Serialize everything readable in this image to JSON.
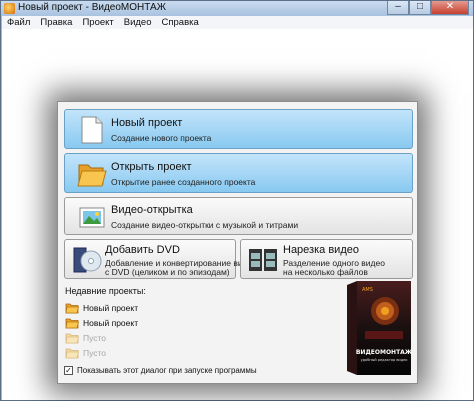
{
  "window": {
    "title": "Новый проект - ВидеоМОНТАЖ",
    "minimize": "–",
    "maximize": "□",
    "close": "✕"
  },
  "menu": [
    "Файл",
    "Правка",
    "Проект",
    "Видео",
    "Справка"
  ],
  "dialog": {
    "new_project": {
      "title": "Новый проект",
      "desc": "Создание нового проекта",
      "icon": "document-icon"
    },
    "open_project": {
      "title": "Открыть проект",
      "desc": "Открытие ранее созданного проекта",
      "icon": "folder-icon"
    },
    "video_card": {
      "title": "Видео-открытка",
      "desc": "Создание видео-открытки с музыкой и титрами",
      "icon": "postcard-icon"
    },
    "add_dvd": {
      "title": "Добавить DVD",
      "desc_line1": "Добавление и конвертирование видео",
      "desc_line2": "с DVD (целиком и по эпизодам)",
      "icon": "dvd-icon"
    },
    "cut_video": {
      "title": "Нарезка видео",
      "desc_line1": "Разделение одного видео",
      "desc_line2": "на несколько файлов",
      "icon": "film-icon"
    },
    "recent_label": "Недавние проекты:",
    "recent": [
      {
        "label": "Новый проект",
        "empty": false
      },
      {
        "label": "Новый проект",
        "empty": false
      },
      {
        "label": "Пусто",
        "empty": true
      },
      {
        "label": "Пусто",
        "empty": true
      }
    ],
    "show_on_start": {
      "label": "Показывать этот диалог при запуске программы",
      "checked": true
    },
    "product": {
      "brand": "AMS",
      "name": "ВИДЕОМОНТАЖ",
      "tagline": "удобный редактор видео"
    }
  },
  "colors": {
    "active_card": "#88c9f0",
    "accent": "#f0a020"
  }
}
